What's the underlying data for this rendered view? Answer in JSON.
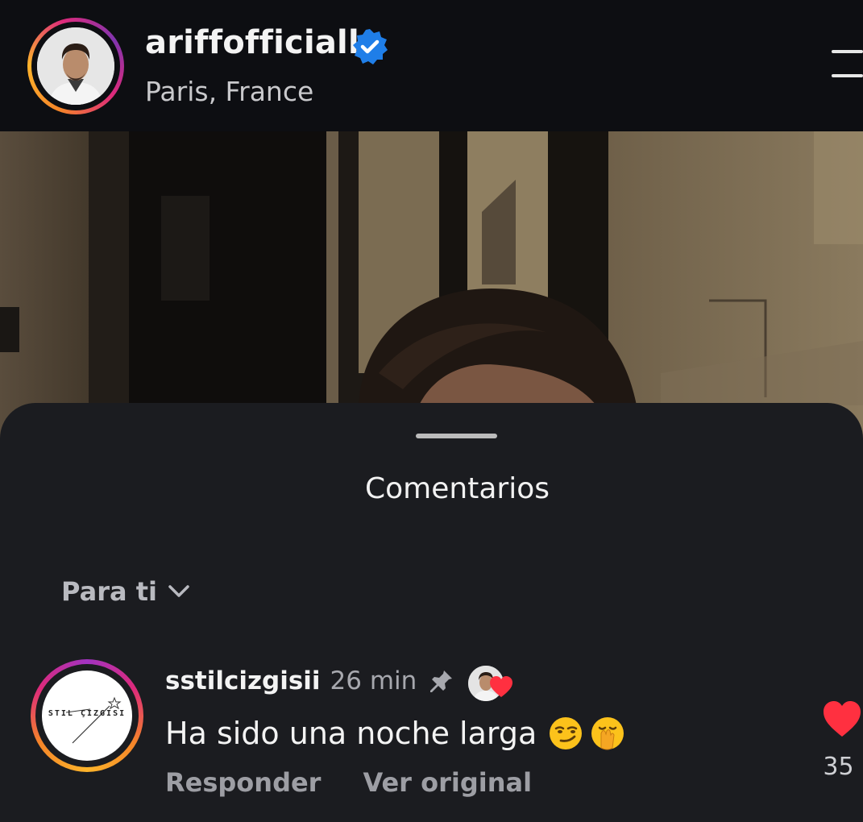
{
  "header": {
    "username": "ariffofficiall",
    "location": "Paris, France",
    "verified": true
  },
  "sheet": {
    "title": "Comentarios",
    "sort_label": "Para ti"
  },
  "comment": {
    "username": "sstilcizgisii",
    "time": "26 min",
    "text": "Ha sido una noche larga",
    "emojis": [
      "smirking-face",
      "face-with-hand-over-mouth"
    ],
    "avatar_logo_text": "STIL ÇIZGISI",
    "reply_label": "Responder",
    "translate_label": "Ver original",
    "like_count": "35",
    "pinned": true,
    "liked_by_creator": true
  },
  "colors": {
    "background": "#0c0d10",
    "sheet": "#1b1c20",
    "verified": "#1f7ee8",
    "heart": "#ff3040",
    "muted_text": "#9d9ea4"
  }
}
